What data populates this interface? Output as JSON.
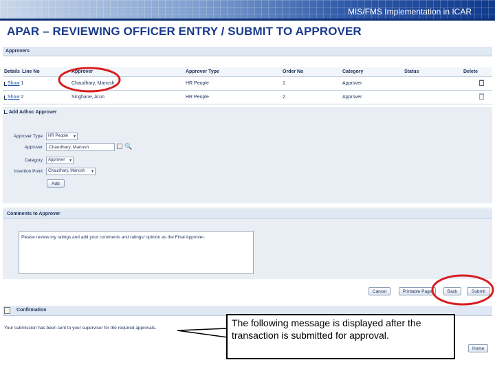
{
  "header": {
    "banner_title": "MIS/FMS Implementation in ICAR",
    "slide_title": "APAR – REVIEWING OFFICER ENTRY / SUBMIT TO APPROVER"
  },
  "approvers": {
    "section_title": "Approvers",
    "columns": [
      "Details",
      "Line No",
      "Approver",
      "Approver Type",
      "Order No",
      "Category",
      "Status",
      "Delete"
    ],
    "rows": [
      {
        "show": "Show",
        "line_no": "1",
        "approver": "Chaudhary, Manosh",
        "approver_type": "HR People",
        "order_no": "1",
        "category": "Approver",
        "status": ""
      },
      {
        "show": "Show",
        "line_no": "2",
        "approver": "Singhane, Arun",
        "approver_type": "HR People",
        "order_no": "2",
        "category": "Approver",
        "status": ""
      }
    ]
  },
  "adhoc": {
    "section_title": "Add Adhoc Approver",
    "approver_type_label": "Approver Type",
    "approver_type_value": "HR People",
    "approver_label": "Approver",
    "approver_value": "Chaudhary, Manosh",
    "category_label": "Category",
    "category_value": "Approver",
    "insertion_point_label": "Insertion Point",
    "insertion_point_value": "Chaudhary, Manosh",
    "add_button": "Add"
  },
  "comments": {
    "section_title": "Comments to Approver",
    "text": "Please review my ratings and add your comments and ratings/ opinion as the Final Approver."
  },
  "actions": {
    "cancel": "Cancel",
    "printable_page": "Printable Page",
    "back": "Back",
    "submit": "Submit"
  },
  "confirmation": {
    "section_title": "Confirmation",
    "message": "Your submission has been sent to your supervisor for the required approvals.",
    "home_button": "Home"
  },
  "callout": {
    "text": "The following message is displayed after the transaction is submitted for approval."
  },
  "colors": {
    "highlight_circle": "#d81e1e",
    "title_blue": "#1a3a8c"
  }
}
